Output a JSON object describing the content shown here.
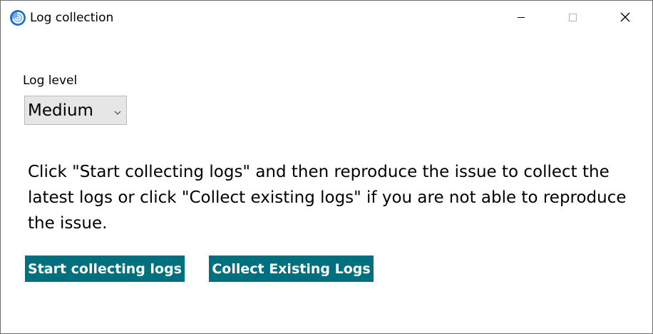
{
  "window": {
    "title": "Log collection",
    "app_icon": "swirl-app-icon",
    "controls": {
      "minimize_icon": "minimize-icon",
      "maximize_icon": "maximize-icon",
      "close_icon": "close-icon"
    }
  },
  "log_level": {
    "label": "Log level",
    "selected": "Medium",
    "chevron_icon": "chevron-down-icon"
  },
  "instructions": {
    "text": "Click \"Start collecting logs\" and then reproduce the issue to collect the latest logs or click \"Collect existing logs\" if you are not able to reproduce the issue."
  },
  "actions": {
    "start_label": "Start collecting logs",
    "collect_label": "Collect Existing Logs"
  },
  "colors": {
    "accent": "#00707f",
    "icon_blue": "#1d72c6",
    "select_bg": "#e6e6e6"
  }
}
